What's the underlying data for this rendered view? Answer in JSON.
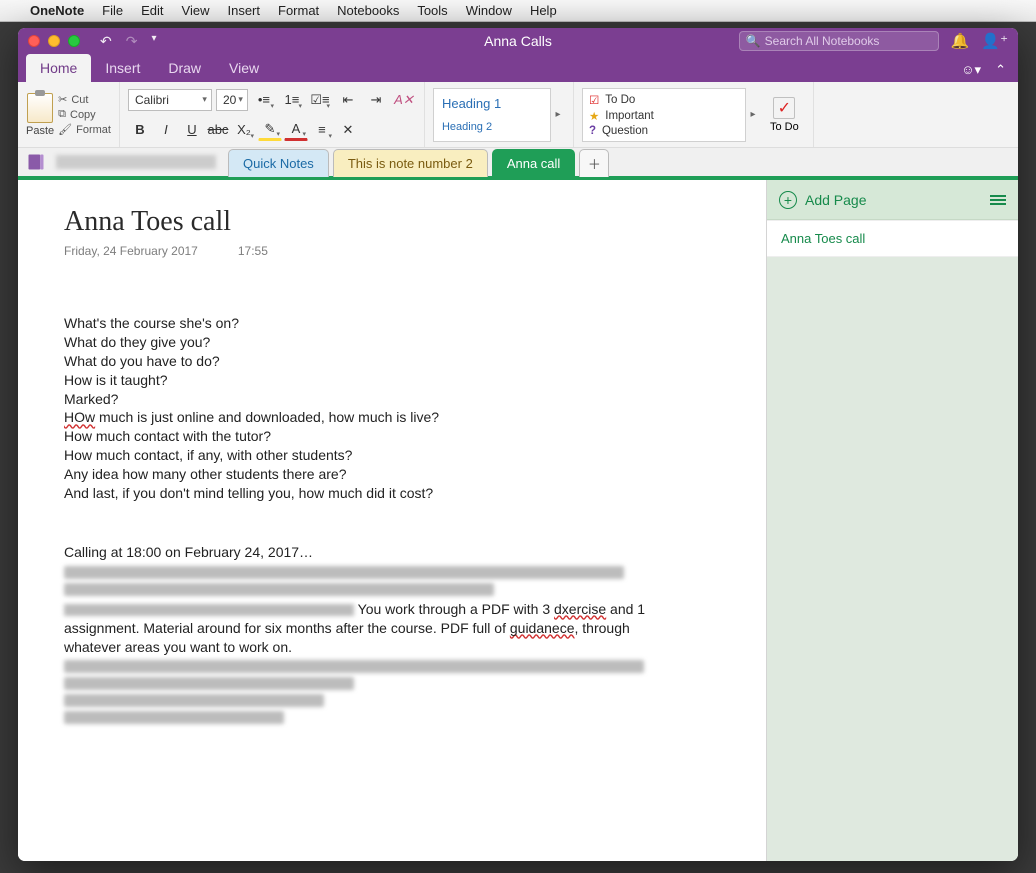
{
  "mac_menu": {
    "app": "OneNote",
    "items": [
      "File",
      "Edit",
      "View",
      "Insert",
      "Format",
      "Notebooks",
      "Tools",
      "Window",
      "Help"
    ]
  },
  "titlebar": {
    "doc_title": "Anna Calls",
    "search_placeholder": "Search All Notebooks"
  },
  "ribbon_tabs": [
    "Home",
    "Insert",
    "Draw",
    "View"
  ],
  "ribbon": {
    "paste": "Paste",
    "cut": "Cut",
    "copy": "Copy",
    "format": "Format",
    "font_name": "Calibri",
    "font_size": "20",
    "heading1": "Heading 1",
    "heading2": "Heading 2",
    "tag_todo": "To Do",
    "tag_important": "Important",
    "tag_question": "Question",
    "todo": "To Do"
  },
  "section_tabs": {
    "t1": "Quick Notes",
    "t2": "This is note number 2",
    "t3": "Anna call"
  },
  "page": {
    "title": "Anna Toes call",
    "date": "Friday, 24 February 2017",
    "time": "17:55",
    "lines": [
      "What's the course she's on?",
      "What do they give you?",
      "What do you have to do?",
      "How is it taught?",
      "Marked?",
      "HOw much is just online and downloaded, how much is live?",
      "How much contact with the tutor?",
      "How much contact, if any, with other students?",
      "Any idea how many other students there are?",
      "And last, if you don't mind telling you, how much did it cost?"
    ],
    "calling": "Calling at 18:00 on February 24, 2017…",
    "mid_a": "You work through a PDF with 3 ",
    "mid_err1": "dxercise",
    "mid_b": " and 1 assignment. Material around for six months after the course. PDF full of ",
    "mid_err2": "guidanece",
    "mid_c": ", through whatever areas you want to work on."
  },
  "pagelist": {
    "add": "Add Page",
    "item1": "Anna Toes call"
  }
}
